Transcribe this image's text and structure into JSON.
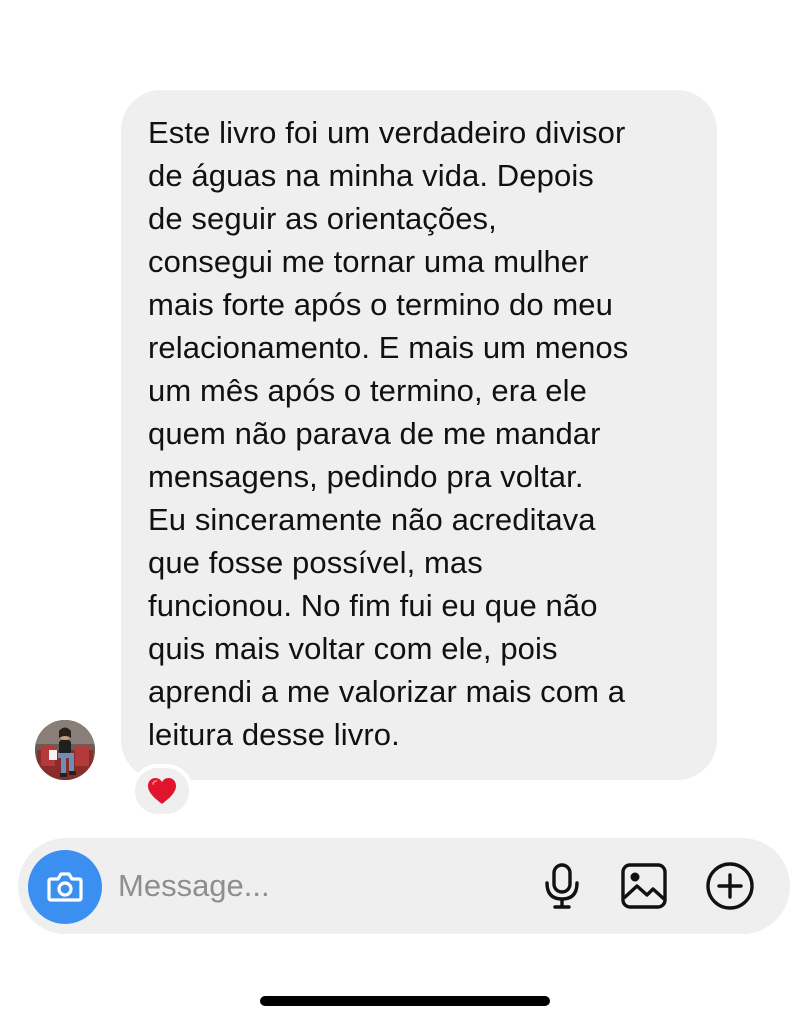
{
  "thread": {
    "message_text": "Este livro foi um verdadeiro divisor\nde águas na minha vida. Depois\nde seguir as orientações,\nconsegui me tornar uma mulher\nmais forte após o termino do meu\nrelacionamento. E mais um menos\num mês após o termino, era ele\nquem não parava de me mandar\nmensagens, pedindo pra voltar.\nEu sinceramente não acreditava\nque fosse possível, mas\nfuncionou. No fim fui eu que não\nquis mais voltar com ele, pois\naprendi a me valorizar mais com a\nleitura desse livro.",
    "reaction": "heart",
    "reaction_color": "#e0142c",
    "sender_avatar": "user-photo-avatar"
  },
  "composer": {
    "placeholder": "Message...",
    "value": "",
    "camera_icon": "camera-icon",
    "camera_color": "#3b8ff0",
    "mic_icon": "microphone-icon",
    "gallery_icon": "image-icon",
    "plus_icon": "plus-circle-icon"
  },
  "colors": {
    "bubble": "#efefef",
    "text": "#111111",
    "placeholder": "#8e8e8e"
  }
}
